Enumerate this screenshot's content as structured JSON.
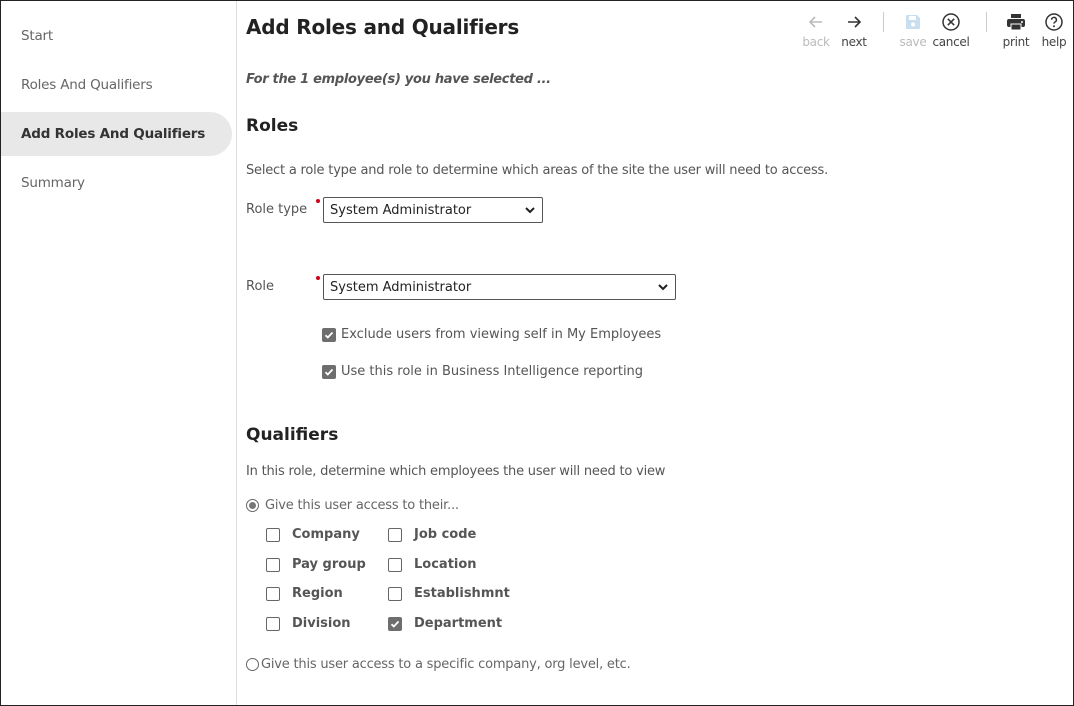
{
  "sidebar": {
    "items": [
      {
        "label": "Start",
        "active": false
      },
      {
        "label": "Roles And Qualifiers",
        "active": false
      },
      {
        "label": "Add Roles And Qualifiers",
        "active": true
      },
      {
        "label": "Summary",
        "active": false
      }
    ]
  },
  "header": {
    "title": "Add Roles and Qualifiers",
    "toolbar": {
      "back": {
        "label": "back",
        "icon": "arrow-left-icon",
        "enabled": false
      },
      "next": {
        "label": "next",
        "icon": "arrow-right-icon",
        "enabled": true
      },
      "save": {
        "label": "save",
        "icon": "save-icon",
        "enabled": false
      },
      "cancel": {
        "label": "cancel",
        "icon": "cancel-icon",
        "enabled": true
      },
      "print": {
        "label": "print",
        "icon": "print-icon",
        "enabled": true
      },
      "help": {
        "label": "help",
        "icon": "help-icon",
        "enabled": true
      }
    }
  },
  "main": {
    "subtitle": "For the 1 employee(s) you have selected ...",
    "roles": {
      "heading": "Roles",
      "description": "Select a role type and role to determine which areas of the site the user will need to access.",
      "role_type": {
        "label": "Role type",
        "value": "System Administrator",
        "required": true
      },
      "role": {
        "label": "Role",
        "value": "System Administrator",
        "required": true
      },
      "options": [
        {
          "label": "Exclude users from viewing self in My Employees",
          "checked": true
        },
        {
          "label": "Use this role in Business Intelligence reporting",
          "checked": true
        }
      ]
    },
    "qualifiers": {
      "heading": "Qualifiers",
      "description": "In this role, determine which employees the user will need to view",
      "radio_their": {
        "label": "Give this user access to their...",
        "selected": true
      },
      "items": [
        {
          "label": "Company",
          "checked": false
        },
        {
          "label": "Job code",
          "checked": false
        },
        {
          "label": "Pay group",
          "checked": false
        },
        {
          "label": "Location",
          "checked": false
        },
        {
          "label": "Region",
          "checked": false
        },
        {
          "label": "Establishmnt",
          "checked": false
        },
        {
          "label": "Division",
          "checked": false
        },
        {
          "label": "Department",
          "checked": true
        }
      ],
      "radio_specific": {
        "label": "Give this user access to a specific company, org level, etc.",
        "selected": false
      }
    }
  },
  "colors": {
    "required": "#d0021b",
    "active_nav_bg": "#e8e8e8",
    "disabled_icon": "#c9dff0"
  }
}
